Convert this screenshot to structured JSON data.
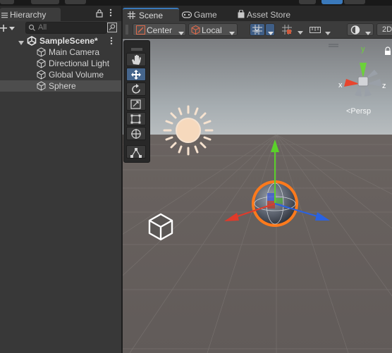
{
  "hierarchy": {
    "tab_label": "Hierarchy",
    "search_placeholder": "All",
    "items": [
      {
        "label": "SampleScene*"
      },
      {
        "label": "Main Camera"
      },
      {
        "label": "Directional Light"
      },
      {
        "label": "Global Volume"
      },
      {
        "label": "Sphere"
      }
    ]
  },
  "scene_tabs": [
    {
      "label": "Scene"
    },
    {
      "label": "Game"
    },
    {
      "label": "Asset Store"
    }
  ],
  "scene_toolbar": {
    "pivot_label": "Center",
    "space_label": "Local",
    "mode_2d_label": "2D"
  },
  "gizmo": {
    "axis_y": "y",
    "axis_x": "x",
    "axis_z": "z",
    "projection_label": "<Persp"
  },
  "colors": {
    "x_axis": "#e03a2a",
    "y_axis": "#5ad12a",
    "z_axis": "#2a62e0",
    "selection": "#f27a22",
    "active_tool": "#45658c"
  }
}
